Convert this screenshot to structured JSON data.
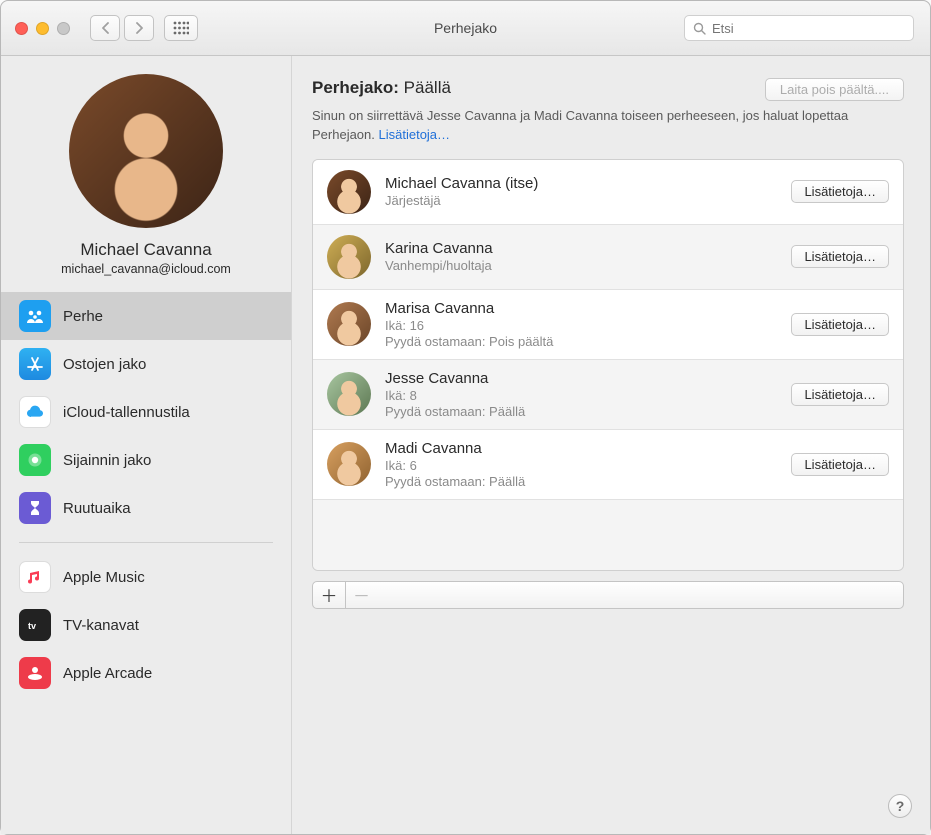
{
  "window": {
    "title": "Perhejako",
    "search_placeholder": "Etsi"
  },
  "sidebar": {
    "user_name": "Michael Cavanna",
    "user_email": "michael_cavanna@icloud.com",
    "items": [
      {
        "label": "Perhe"
      },
      {
        "label": "Ostojen jako"
      },
      {
        "label": "iCloud-tallennustila"
      },
      {
        "label": "Sijainnin jako"
      },
      {
        "label": "Ruutuaika"
      }
    ],
    "items2": [
      {
        "label": "Apple Music"
      },
      {
        "label": "TV-kanavat"
      },
      {
        "label": "Apple Arcade"
      }
    ]
  },
  "main": {
    "heading_prefix": "Perhejako:",
    "heading_status": "Päällä",
    "turn_off_label": "Laita pois päältä....",
    "subtext": "Sinun on siirrettävä Jesse Cavanna ja Madi Cavanna toiseen perheeseen, jos haluat lopettaa Perhejaon. ",
    "subtext_link": "Lisätietoja…",
    "details_label": "Lisätietoja…",
    "members": [
      {
        "name": "Michael Cavanna (itse)",
        "line2": "Järjestäjä",
        "line3": ""
      },
      {
        "name": "Karina Cavanna",
        "line2": "Vanhempi/huoltaja",
        "line3": ""
      },
      {
        "name": "Marisa Cavanna",
        "line2": "Ikä: 16",
        "line3": "Pyydä ostamaan: Pois päältä"
      },
      {
        "name": "Jesse Cavanna",
        "line2": "Ikä: 8",
        "line3": "Pyydä ostamaan: Päällä"
      },
      {
        "name": "Madi Cavanna",
        "line2": "Ikä: 6",
        "line3": "Pyydä ostamaan: Päällä"
      }
    ]
  }
}
